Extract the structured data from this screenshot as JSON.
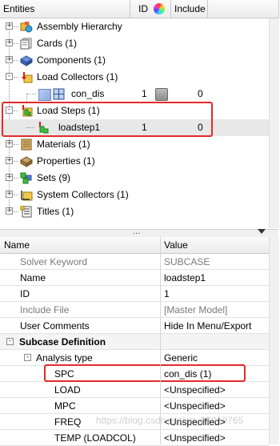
{
  "entities_header": {
    "title": "Entities",
    "id_col": "ID",
    "include_col": "Include"
  },
  "tree": [
    {
      "label": "Assembly Hierarchy",
      "icon": "assembly-icon",
      "expander": "+"
    },
    {
      "label": "Cards (1)",
      "icon": "cards-icon",
      "expander": "+"
    },
    {
      "label": "Components (1)",
      "icon": "components-icon",
      "expander": "+"
    },
    {
      "label": "Load Collectors (1)",
      "icon": "load-collectors-icon",
      "expander": "-"
    },
    {
      "label": "con_dis",
      "icon": "loadcol-item-icon",
      "id": "1",
      "include": "0",
      "child": true
    },
    {
      "label": "Load Steps (1)",
      "icon": "load-steps-icon",
      "expander": "-"
    },
    {
      "label": "loadstep1",
      "icon": "loadstep-item-icon",
      "id": "1",
      "include": "0",
      "child": true
    },
    {
      "label": "Materials (1)",
      "icon": "materials-icon",
      "expander": "+"
    },
    {
      "label": "Properties (1)",
      "icon": "properties-icon",
      "expander": "+"
    },
    {
      "label": "Sets (9)",
      "icon": "sets-icon",
      "expander": "+"
    },
    {
      "label": "System Collectors (1)",
      "icon": "system-collectors-icon",
      "expander": "+"
    },
    {
      "label": "Titles (1)",
      "icon": "titles-icon",
      "expander": "+"
    }
  ],
  "splitter_grip": "...",
  "props_header": {
    "name": "Name",
    "value": "Value"
  },
  "props": [
    {
      "name": "Solver Keyword",
      "value": "SUBCASE",
      "muted": true
    },
    {
      "name": "Name",
      "value": "loadstep1"
    },
    {
      "name": "ID",
      "value": "1"
    },
    {
      "name": "Include File",
      "value": "[Master Model]",
      "muted": true
    },
    {
      "name": "User Comments",
      "value": "Hide In Menu/Export"
    },
    {
      "name": "Subcase Definition",
      "value": "",
      "section": true,
      "expander": "-"
    },
    {
      "name": "Analysis type",
      "value": "Generic",
      "subsection": true,
      "expander": "-"
    },
    {
      "name": "SPC",
      "value": "con_dis (1)",
      "indent": true
    },
    {
      "name": "LOAD",
      "value": "<Unspecified>",
      "indent": true
    },
    {
      "name": "MPC",
      "value": "<Unspecified>",
      "indent": true
    },
    {
      "name": "FREQ",
      "value": "<Unspecified>",
      "indent": true
    },
    {
      "name": "TEMP (LOADCOL)",
      "value": "<Unspecified>",
      "indent": true
    }
  ],
  "watermark": "https://blog.csdn.net/qq_37019765",
  "colors": {
    "highlight_box": "#e32a2a",
    "row_selected": "#e8e8e8"
  }
}
